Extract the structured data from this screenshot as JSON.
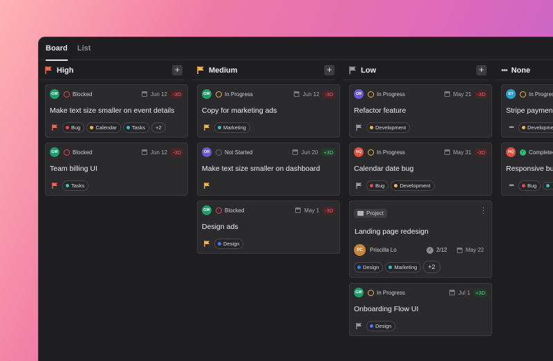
{
  "tabs": [
    {
      "label": "Board"
    },
    {
      "label": "List"
    }
  ],
  "columns": [
    {
      "title": "High",
      "cards": [
        {
          "avatar": "GW",
          "status": "Blocked",
          "date": "Jun 12",
          "delta": "-3D",
          "title": "Make text size smaller on event details",
          "tags": [
            "Bug",
            "Calendar",
            "Tasks"
          ],
          "more": "+2"
        },
        {
          "avatar": "GW",
          "status": "Blocked",
          "date": "Jun 12",
          "delta": "-3D",
          "title": "Team billing UI",
          "tags": [
            "Tasks"
          ]
        }
      ]
    },
    {
      "title": "Medium",
      "cards": [
        {
          "avatar": "GW",
          "status": "In Progress",
          "date": "Jun 12",
          "delta": "-3D",
          "title": "Copy for marketing ads",
          "tags": [
            "Marketing"
          ]
        },
        {
          "avatar": "OR",
          "status": "Not Started",
          "date": "Jun 20",
          "delta": "+3D",
          "title": "Make text size smaller on dashboard",
          "tags": []
        },
        {
          "avatar": "GW",
          "status": "Blocked",
          "date": "May 1",
          "delta": "-3D",
          "title": "Design ads",
          "tags": [
            "Design"
          ]
        }
      ]
    },
    {
      "title": "Low",
      "cards": [
        {
          "avatar": "OR",
          "status": "In Progress",
          "date": "May 21",
          "delta": "-3D",
          "title": "Refactor feature",
          "tags": [
            "Development"
          ]
        },
        {
          "avatar": "HQ",
          "status": "In Progress",
          "date": "May 31",
          "delta": "-3D",
          "title": "Calendar date bug",
          "tags": [
            "Bug",
            "Development"
          ]
        },
        {
          "project_label": "Project",
          "title": "Landing page redesign",
          "assignee_initials": "PC",
          "assignee": "Priscilla Lo",
          "subtasks": "2/12",
          "date": "May 22",
          "tags": [
            "Design",
            "Marketing"
          ],
          "more": "+2"
        },
        {
          "avatar": "GW",
          "status": "In Progress",
          "date": "Jul 1",
          "delta": "+3D",
          "title": "Onboarding Flow UI",
          "tags": [
            "Design"
          ]
        }
      ]
    },
    {
      "title": "None",
      "cards": [
        {
          "avatar": "EY",
          "status": "In Progress",
          "title": "Stripe payment",
          "tags": [
            "Development"
          ]
        },
        {
          "avatar": "HQ",
          "status": "Completed",
          "title": "Responsive bug",
          "tags": [
            "Bug"
          ]
        }
      ]
    }
  ],
  "colors": {
    "high_flag": "#f26a4b",
    "medium_flag": "#f5b547",
    "low_flag": "#9a9aa0",
    "blocked": "#e5484d",
    "in_progress": "#f5b547",
    "completed": "#2fbf71",
    "bug": "#e5484d",
    "calendar": "#f5b547",
    "tasks": "#2ec4c4",
    "marketing": "#2ec4c4",
    "design": "#3e7bfa",
    "development": "#f5b547"
  }
}
